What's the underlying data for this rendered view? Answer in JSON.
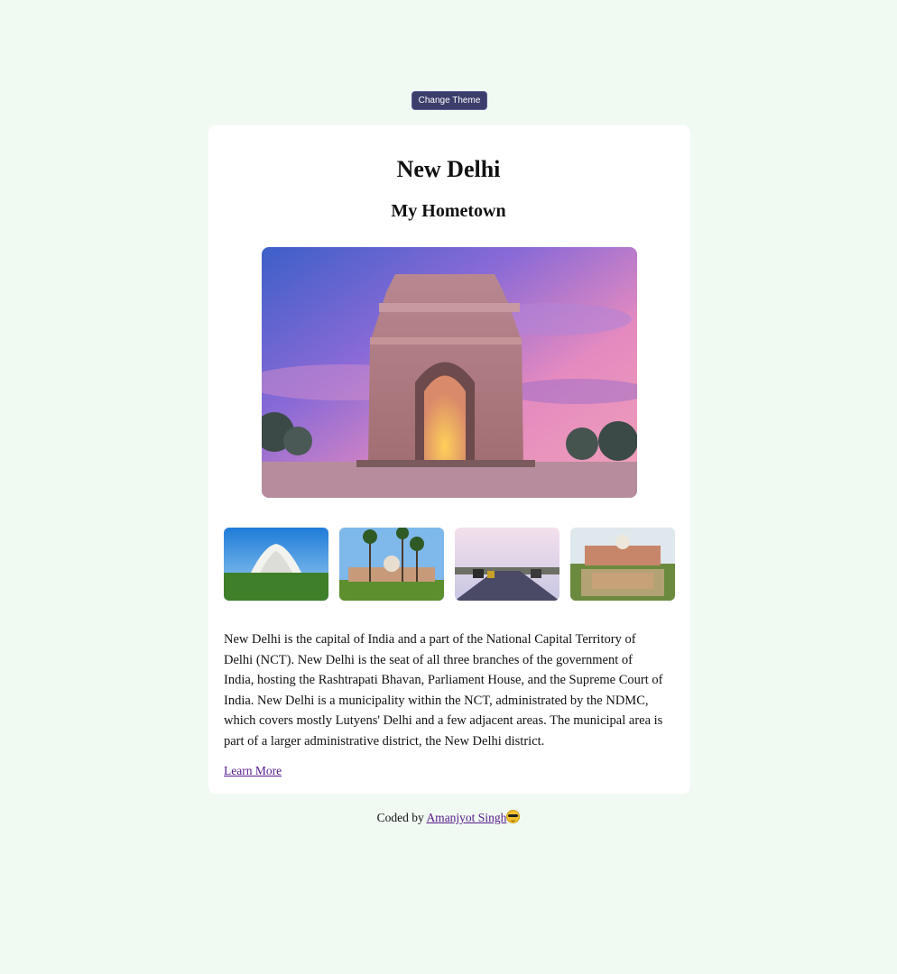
{
  "header": {
    "theme_button_label": "Change Theme"
  },
  "card": {
    "title": "New Delhi",
    "subtitle": "My Hometown",
    "hero_image": "india-gate-photo",
    "thumbnails": [
      {
        "name": "lotus-temple-photo"
      },
      {
        "name": "safdarjung-tomb-photo"
      },
      {
        "name": "rajpath-road-photo"
      },
      {
        "name": "humayun-tomb-photo"
      }
    ],
    "description": "New Delhi is the capital of India and a part of the National Capital Territory of Delhi (NCT). New Delhi is the seat of all three branches of the government of India, hosting the Rashtrapati Bhavan, Parliament House, and the Supreme Court of India. New Delhi is a municipality within the NCT, administrated by the NDMC, which covers mostly Lutyens' Delhi and a few adjacent areas. The municipal area is part of a larger administrative district, the New Delhi district.",
    "learn_more_label": "Learn More"
  },
  "footer": {
    "prefix": "Coded by ",
    "author_link": "Amanjyot Singh",
    "emoji": "sunglasses-emoji"
  },
  "colors": {
    "page_background": "#f1faf2",
    "button_background": "#3b3e6a",
    "link": "#551a8b"
  }
}
